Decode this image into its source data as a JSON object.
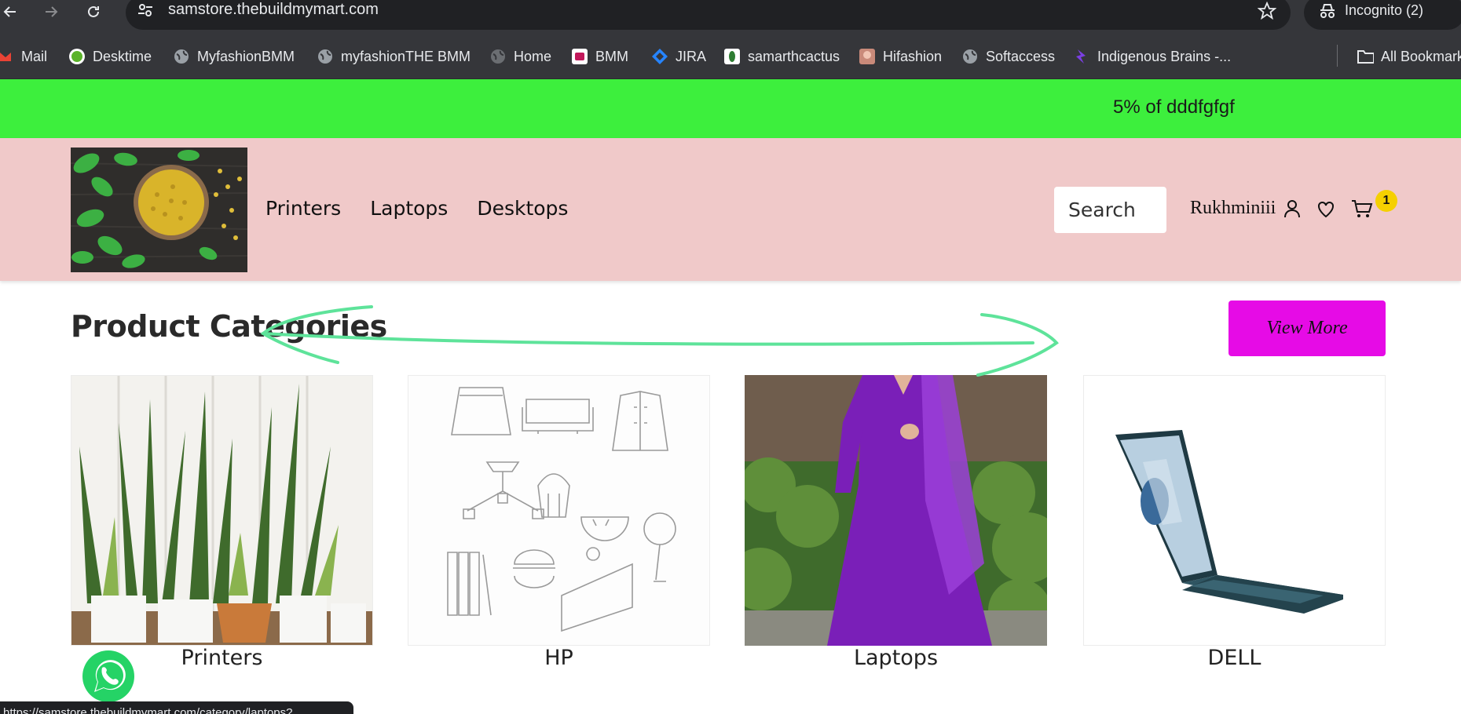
{
  "browser": {
    "url": "samstore.thebuildmymart.com",
    "incognito_label": "Incognito (2)",
    "bookmarks": [
      {
        "label": "Mail",
        "icon": "gmail-icon"
      },
      {
        "label": "Desktime",
        "icon": "desktime-icon"
      },
      {
        "label": "MyfashionBMM",
        "icon": "globe-icon"
      },
      {
        "label": "myfashionTHE BMM",
        "icon": "globe-icon"
      },
      {
        "label": "Home",
        "icon": "globe-icon"
      },
      {
        "label": "BMM",
        "icon": "bmm-icon"
      },
      {
        "label": "JIRA",
        "icon": "jira-icon"
      },
      {
        "label": "samarthcactus",
        "icon": "cactus-icon"
      },
      {
        "label": "Hifashion",
        "icon": "avatar-icon"
      },
      {
        "label": "Softaccess",
        "icon": "globe-icon"
      },
      {
        "label": "Indigenous Brains -...",
        "icon": "brain-icon"
      },
      {
        "label": "All Bookmarks",
        "icon": "folder-icon"
      }
    ],
    "status_url": "https://samstore.thebuildmymart.com/category/laptops?"
  },
  "promo": {
    "text": "5% of dddfgfgf",
    "color": "#3def3d"
  },
  "header": {
    "nav": [
      "Printers",
      "Laptops",
      "Desktops"
    ],
    "search_placeholder": "Search",
    "user_name": "Rukhminiii",
    "cart_count": "1",
    "background": "#f0c9c9"
  },
  "categories": {
    "title": "Product Categories",
    "view_more": "View More",
    "view_more_color": "#e60be6",
    "items": [
      {
        "label": "Printers",
        "image": "snake-plants-photo"
      },
      {
        "label": "HP",
        "image": "line-art-illustration"
      },
      {
        "label": "Laptops",
        "image": "purple-dress-photo"
      },
      {
        "label": "DELL",
        "image": "laptop-photo"
      }
    ]
  }
}
